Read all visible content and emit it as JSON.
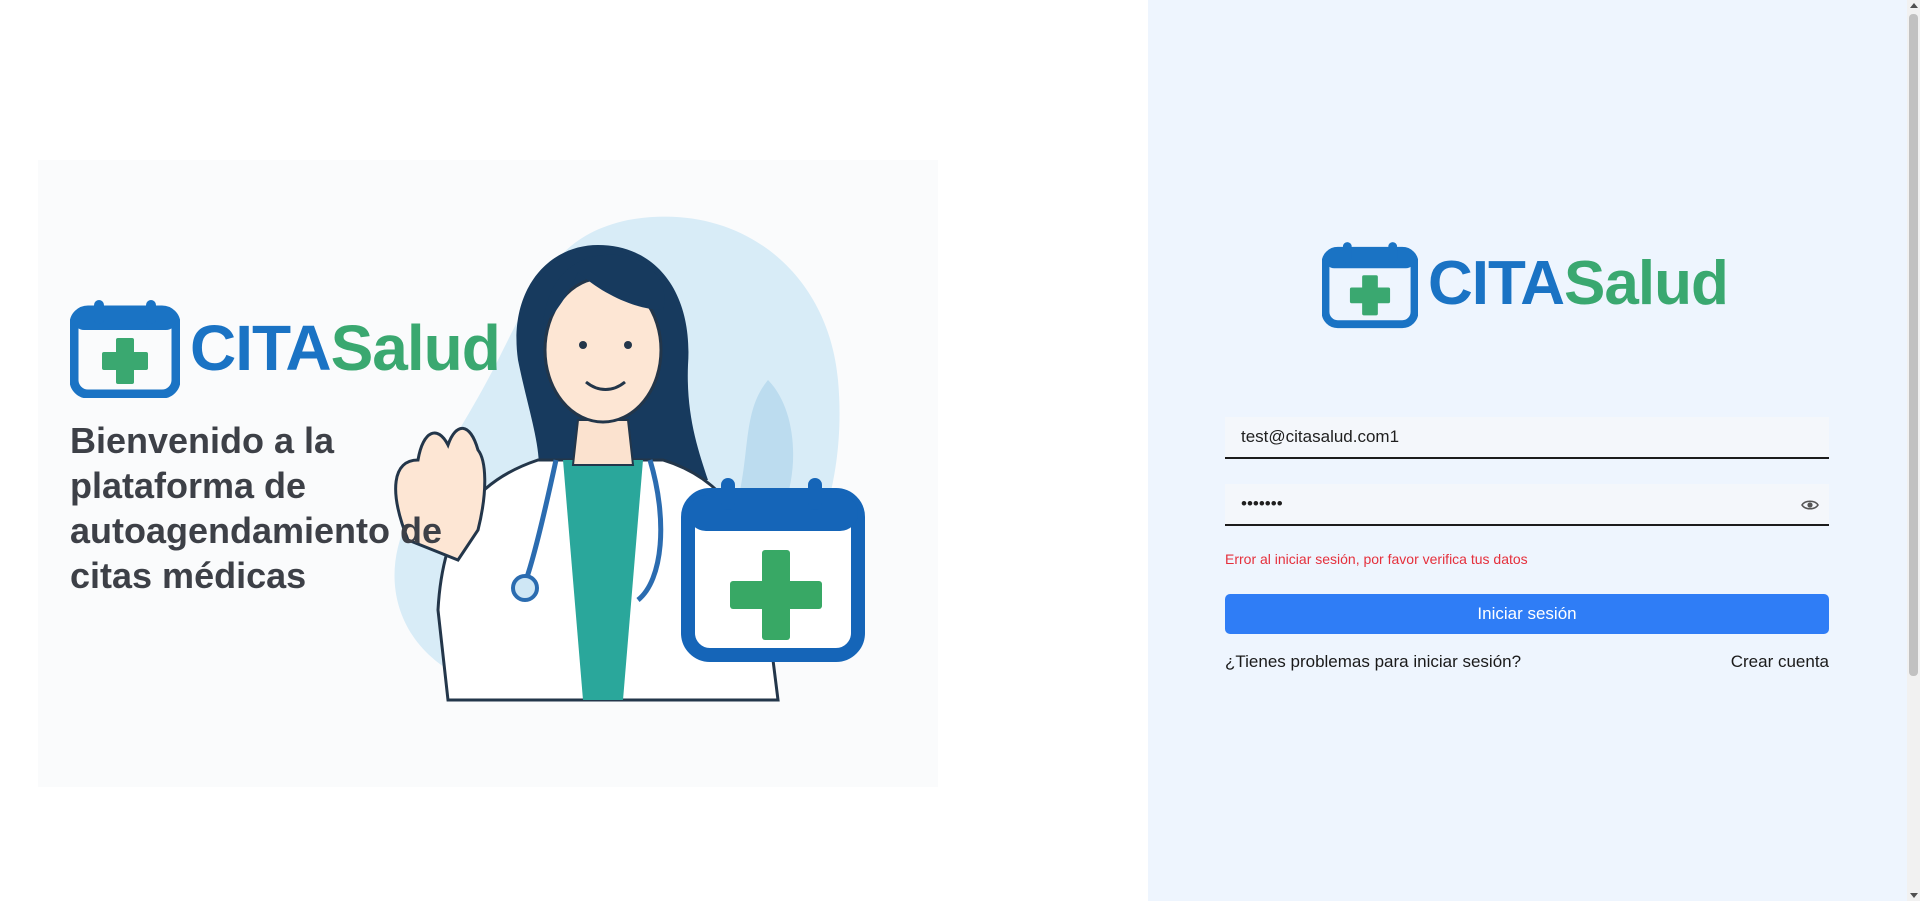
{
  "colors": {
    "brand_blue": "#1a73c4",
    "brand_green": "#3aa870",
    "panel_background": "#eef5fe",
    "button_blue": "#2f7df6",
    "error_red": "#e5303c"
  },
  "hero": {
    "logo": {
      "part1": "CITA",
      "part2": "Salud",
      "icon": "calendar-plus-icon"
    },
    "welcome_text": "Bienvenido a la plataforma de autoagendamiento de citas médicas",
    "illustration": "doctor-waving-illustration"
  },
  "login": {
    "logo": {
      "part1": "CITA",
      "part2": "Salud",
      "icon": "calendar-plus-icon"
    },
    "email": {
      "value": "test@citasalud.com1"
    },
    "password": {
      "value": "•••••••",
      "toggle_icon": "eye-icon"
    },
    "error_message": "Error al iniciar sesión, por favor verifica tus datos",
    "submit_label": "Iniciar sesión",
    "help_link": "¿Tienes problemas para iniciar sesión?",
    "signup_link": "Crear cuenta"
  }
}
